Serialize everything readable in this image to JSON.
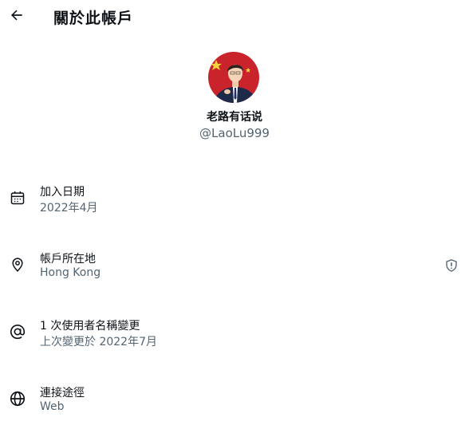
{
  "header": {
    "back_icon": "arrow-left-icon",
    "title": "關於此帳戶"
  },
  "profile": {
    "display_name": "老路有话说",
    "handle": "@LaoLu999"
  },
  "info_rows": [
    {
      "icon": "calendar-icon",
      "label": "加入日期",
      "value": "2022年4月"
    },
    {
      "icon": "location-pin-icon",
      "label": "帳戶所在地",
      "value": "Hong Kong",
      "badge_icon": "shield-info-icon"
    },
    {
      "icon": "at-sign-icon",
      "label": "1 次使用者名稱變更",
      "value": "上次變更於 2022年7月"
    },
    {
      "icon": "globe-icon",
      "label": "連接途徑",
      "value": "Web"
    }
  ],
  "colors": {
    "primary_text": "#0f1419",
    "secondary_text": "#536471",
    "background": "#ffffff",
    "avatar_background": "#c9242b"
  }
}
